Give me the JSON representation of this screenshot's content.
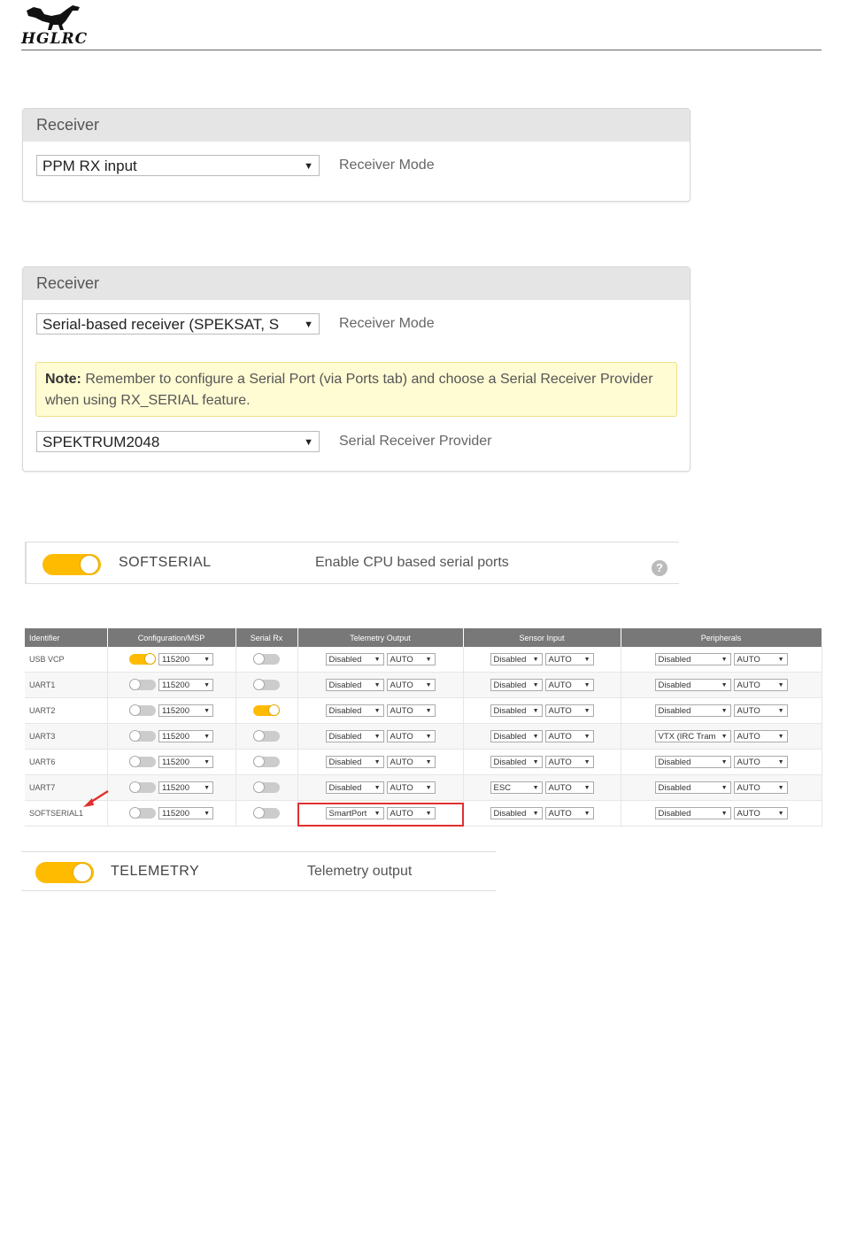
{
  "header": {
    "logo_text": "HGLRC"
  },
  "receiver1": {
    "title": "Receiver",
    "mode_value": "PPM RX input",
    "mode_label": "Receiver Mode"
  },
  "receiver2": {
    "title": "Receiver",
    "mode_value": "Serial-based receiver (SPEKSAT, S",
    "mode_label": "Receiver Mode",
    "note_bold": "Note:",
    "note_text": " Remember to configure a Serial Port (via Ports tab) and choose a Serial Receiver Provider when using RX_SERIAL feature.",
    "provider_value": "SPEKTRUM2048",
    "provider_label": "Serial Receiver Provider"
  },
  "softserial": {
    "name": "SOFTSERIAL",
    "description": "Enable CPU based serial ports",
    "help": "?"
  },
  "ports": {
    "headers": [
      "Identifier",
      "Configuration/MSP",
      "Serial Rx",
      "Telemetry Output",
      "Sensor Input",
      "Peripherals"
    ],
    "rows": [
      {
        "id": "USB VCP",
        "msp_on": true,
        "baud": "115200",
        "rx_on": false,
        "telem": "Disabled",
        "telem_baud": "AUTO",
        "sensor": "Disabled",
        "sensor_baud": "AUTO",
        "periph": "Disabled",
        "periph_baud": "AUTO"
      },
      {
        "id": "UART1",
        "msp_on": false,
        "baud": "115200",
        "rx_on": false,
        "telem": "Disabled",
        "telem_baud": "AUTO",
        "sensor": "Disabled",
        "sensor_baud": "AUTO",
        "periph": "Disabled",
        "periph_baud": "AUTO"
      },
      {
        "id": "UART2",
        "msp_on": false,
        "baud": "115200",
        "rx_on": true,
        "telem": "Disabled",
        "telem_baud": "AUTO",
        "sensor": "Disabled",
        "sensor_baud": "AUTO",
        "periph": "Disabled",
        "periph_baud": "AUTO"
      },
      {
        "id": "UART3",
        "msp_on": false,
        "baud": "115200",
        "rx_on": false,
        "telem": "Disabled",
        "telem_baud": "AUTO",
        "sensor": "Disabled",
        "sensor_baud": "AUTO",
        "periph": "VTX (IRC Tram",
        "periph_baud": "AUTO"
      },
      {
        "id": "UART6",
        "msp_on": false,
        "baud": "115200",
        "rx_on": false,
        "telem": "Disabled",
        "telem_baud": "AUTO",
        "sensor": "Disabled",
        "sensor_baud": "AUTO",
        "periph": "Disabled",
        "periph_baud": "AUTO"
      },
      {
        "id": "UART7",
        "msp_on": false,
        "baud": "115200",
        "rx_on": false,
        "telem": "Disabled",
        "telem_baud": "AUTO",
        "sensor": "ESC",
        "sensor_baud": "AUTO",
        "periph": "Disabled",
        "periph_baud": "AUTO"
      },
      {
        "id": "SOFTSERIAL1",
        "msp_on": false,
        "baud": "115200",
        "rx_on": false,
        "telem": "SmartPort",
        "telem_baud": "AUTO",
        "sensor": "Disabled",
        "sensor_baud": "AUTO",
        "periph": "Disabled",
        "periph_baud": "AUTO"
      }
    ]
  },
  "telemetry": {
    "name": "TELEMETRY",
    "description": "Telemetry output"
  },
  "colors": {
    "accent": "#ffbb00",
    "table_header": "#787878",
    "highlight": "#e03030",
    "note_bg": "#fffbd3"
  }
}
